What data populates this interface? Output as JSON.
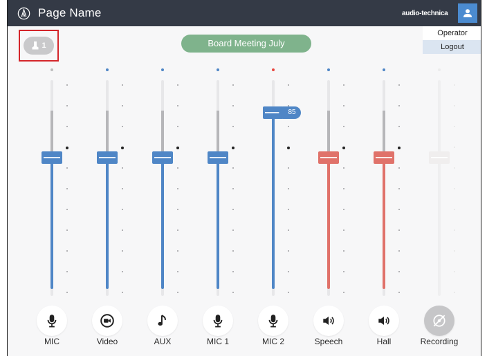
{
  "header": {
    "page_name": "Page Name",
    "brand": "audio-technica",
    "logo_icon": "audio-technica-logo-icon",
    "user_icon": "user-icon",
    "colors": {
      "bar": "#343a46",
      "user_button": "#4b8bd0"
    }
  },
  "user_menu": {
    "role": "Operator",
    "logout": "Logout"
  },
  "mic_badge": {
    "count": "1",
    "icon": "microphone-icon"
  },
  "preset": {
    "label": "Board Meeting July",
    "color": "#7fb38c"
  },
  "colors": {
    "blue": "#4f86c6",
    "red": "#e0726a",
    "indicator_red": "#e8463f",
    "indicator_blue": "#4f86c6",
    "indicator_grey": "#bdbdbd"
  },
  "channels": [
    {
      "label": "MIC",
      "icon": "microphone-icon",
      "color": "blue",
      "level": 0.64,
      "peak": 0.86,
      "indicator": "grey"
    },
    {
      "label": "Video",
      "icon": "video-camera-icon",
      "color": "blue",
      "level": 0.64,
      "peak": 0.86,
      "indicator": "blue"
    },
    {
      "label": "AUX",
      "icon": "music-note-icon",
      "color": "blue",
      "level": 0.64,
      "peak": 0.86,
      "indicator": "blue"
    },
    {
      "label": "MIC 1",
      "icon": "microphone-icon",
      "color": "blue",
      "level": 0.64,
      "peak": 0.86,
      "indicator": "blue"
    },
    {
      "label": "MIC 2",
      "icon": "microphone-icon",
      "color": "blue",
      "level": 0.85,
      "peak": 0.86,
      "indicator": "red",
      "badge": "85"
    },
    {
      "label": "Speech",
      "icon": "speaker-icon",
      "color": "red",
      "level": 0.64,
      "peak": 0.86,
      "indicator": "blue"
    },
    {
      "label": "Hall",
      "icon": "speaker-icon",
      "color": "red",
      "level": 0.64,
      "peak": 0.86,
      "indicator": "blue"
    },
    {
      "label": "Recording",
      "icon": "record-disc-icon",
      "color": "disabled",
      "level": 0.64,
      "peak": 0.86,
      "indicator": "none"
    }
  ]
}
